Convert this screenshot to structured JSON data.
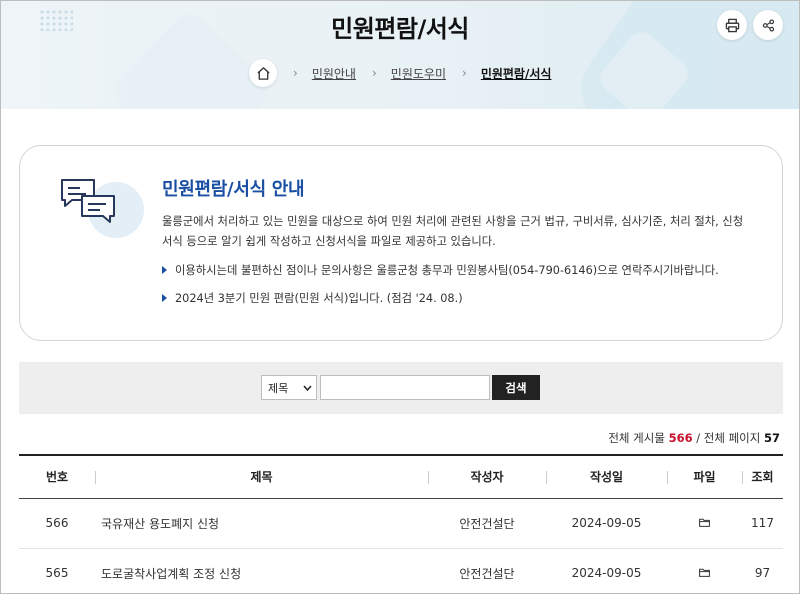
{
  "header": {
    "title": "민원편람/서식",
    "print_icon": "print-icon",
    "share_icon": "share-icon"
  },
  "breadcrumb": {
    "home_icon": "home-icon",
    "items": [
      "민원안내",
      "민원도우미",
      "민원편람/서식"
    ]
  },
  "info": {
    "icon": "speech-bubbles-icon",
    "title": "민원편람/서식 안내",
    "desc_line1": "울릉군에서 처리하고 있는 민원을 대상으로 하여 민원 처리에 관련된 사항을 근거 법규, 구비서류, 심사기준, 처리 절차, 신청",
    "desc_line2": "서식 등으로 알기 쉽게 작성하고 신청서식을 파일로 제공하고 있습니다.",
    "bullets": [
      "이용하시는데 불편하신 점이나 문의사항은 울릉군청 총무과 민원봉사팀(054-790-6146)으로 연락주시기바랍니다.",
      "2024년 3분기 민원 편람(민원 서식)입니다. (점검 '24. 08.)"
    ]
  },
  "search": {
    "select_value": "제목",
    "input_value": "",
    "button_label": "검색"
  },
  "count": {
    "label_total": "전체 게시물",
    "total": "566",
    "divider": "/",
    "label_pages": "전체 페이지",
    "pages": "57"
  },
  "table": {
    "headers": [
      "번호",
      "제목",
      "작성자",
      "작성일",
      "파일",
      "조회"
    ],
    "rows": [
      {
        "no": "566",
        "title": "국유재산 용도폐지 신청",
        "author": "안전건설단",
        "date": "2024-09-05",
        "file_icon": "folder-icon",
        "views": "117"
      },
      {
        "no": "565",
        "title": "도로굴착사업계획 조정 신청",
        "author": "안전건설단",
        "date": "2024-09-05",
        "file_icon": "folder-icon",
        "views": "97"
      }
    ]
  },
  "colors": {
    "accent": "#1a4fa3",
    "count_highlight": "#c8102e",
    "search_button": "#222222"
  }
}
